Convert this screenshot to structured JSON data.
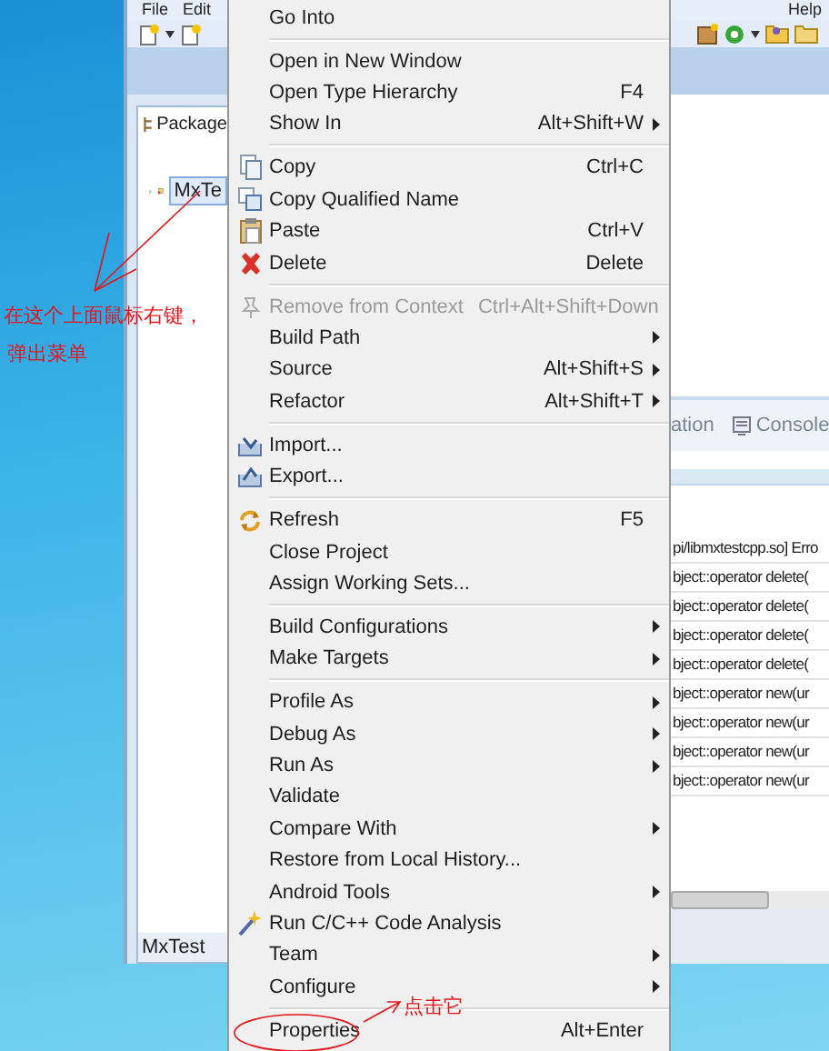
{
  "menu_bar": [
    "File",
    "Edit",
    "Help"
  ],
  "package_explorer": {
    "tab": "Package",
    "tree": [
      {
        "label": "MxTe",
        "expanded": false,
        "selected": true
      }
    ],
    "footer": "MxTest"
  },
  "bottom_panel": {
    "tabs": [
      "ation",
      "Console"
    ],
    "rows": [
      "pi/libmxtestcpp.so] Erro",
      "bject::operator delete(",
      "bject::operator delete(",
      "bject::operator delete(",
      "bject::operator delete(",
      "bject::operator new(ur",
      "bject::operator new(ur",
      "bject::operator new(ur",
      "bject::operator new(ur"
    ]
  },
  "context_menu": [
    {
      "kind": "item",
      "label": "Go Into",
      "submenu": false,
      "disabled": false
    },
    {
      "kind": "separator"
    },
    {
      "kind": "item",
      "label": "Open in New Window",
      "submenu": false,
      "disabled": false
    },
    {
      "kind": "item",
      "label": "Open Type Hierarchy",
      "shortcut": "F4",
      "submenu": false,
      "disabled": false
    },
    {
      "kind": "item",
      "label": "Show In",
      "shortcut": "Alt+Shift+W",
      "submenu": true,
      "disabled": false
    },
    {
      "kind": "separator"
    },
    {
      "kind": "item",
      "label": "Copy",
      "shortcut": "Ctrl+C",
      "submenu": false,
      "disabled": false
    },
    {
      "kind": "item",
      "label": "Copy Qualified Name",
      "submenu": false,
      "disabled": false
    },
    {
      "kind": "item",
      "label": "Paste",
      "shortcut": "Ctrl+V",
      "submenu": false,
      "disabled": false
    },
    {
      "kind": "item",
      "label": "Delete",
      "shortcut": "Delete",
      "submenu": false,
      "disabled": false
    },
    {
      "kind": "separator"
    },
    {
      "kind": "item",
      "label": "Remove from Context",
      "shortcut": "Ctrl+Alt+Shift+Down",
      "submenu": false,
      "disabled": true
    },
    {
      "kind": "item",
      "label": "Build Path",
      "submenu": true,
      "disabled": false
    },
    {
      "kind": "item",
      "label": "Source",
      "shortcut": "Alt+Shift+S",
      "submenu": true,
      "disabled": false
    },
    {
      "kind": "item",
      "label": "Refactor",
      "shortcut": "Alt+Shift+T",
      "submenu": true,
      "disabled": false
    },
    {
      "kind": "separator"
    },
    {
      "kind": "item",
      "label": "Import...",
      "submenu": false,
      "disabled": false
    },
    {
      "kind": "item",
      "label": "Export...",
      "submenu": false,
      "disabled": false
    },
    {
      "kind": "separator"
    },
    {
      "kind": "item",
      "label": "Refresh",
      "shortcut": "F5",
      "submenu": false,
      "disabled": false
    },
    {
      "kind": "item",
      "label": "Close Project",
      "submenu": false,
      "disabled": false
    },
    {
      "kind": "item",
      "label": "Assign Working Sets...",
      "submenu": false,
      "disabled": false
    },
    {
      "kind": "separator"
    },
    {
      "kind": "item",
      "label": "Build Configurations",
      "submenu": true,
      "disabled": false
    },
    {
      "kind": "item",
      "label": "Make Targets",
      "submenu": true,
      "disabled": false
    },
    {
      "kind": "separator"
    },
    {
      "kind": "item",
      "label": "Profile As",
      "submenu": true,
      "disabled": false
    },
    {
      "kind": "item",
      "label": "Debug As",
      "submenu": true,
      "disabled": false
    },
    {
      "kind": "item",
      "label": "Run As",
      "submenu": true,
      "disabled": false
    },
    {
      "kind": "item",
      "label": "Validate",
      "submenu": false,
      "disabled": false
    },
    {
      "kind": "item",
      "label": "Compare With",
      "submenu": true,
      "disabled": false
    },
    {
      "kind": "item",
      "label": "Restore from Local History...",
      "submenu": false,
      "disabled": false
    },
    {
      "kind": "item",
      "label": "Android Tools",
      "submenu": true,
      "disabled": false
    },
    {
      "kind": "item",
      "label": "Run C/C++ Code Analysis",
      "submenu": false,
      "disabled": false
    },
    {
      "kind": "item",
      "label": "Team",
      "submenu": true,
      "disabled": false
    },
    {
      "kind": "item",
      "label": "Configure",
      "submenu": true,
      "disabled": false
    },
    {
      "kind": "separator"
    },
    {
      "kind": "item",
      "label": "Properties",
      "shortcut": "Alt+Enter",
      "submenu": false,
      "disabled": false
    }
  ],
  "annotations": [
    {
      "text": "在这个上面鼠标右键，"
    },
    {
      "text": "弹出菜单"
    },
    {
      "text": "点击它"
    }
  ]
}
